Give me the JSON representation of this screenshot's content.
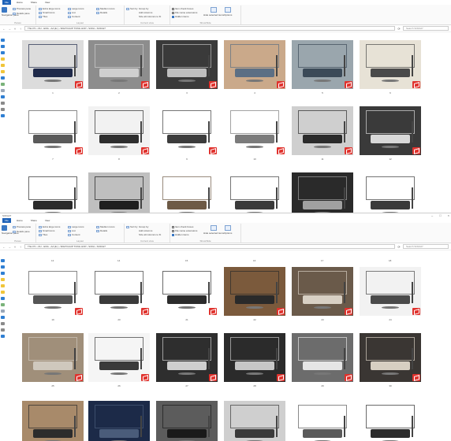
{
  "windows": [
    {
      "tabs": [
        "File",
        "Home",
        "Share",
        "View"
      ],
      "ribbon": {
        "pane_group": {
          "label": "Panes",
          "items": [
            "Navigation pane",
            "Preview pane",
            "Details pane"
          ]
        },
        "layout_group": {
          "label": "Layout",
          "items": [
            "Extra large icons",
            "Large icons",
            "Medium icons",
            "Small icons",
            "List",
            "Details",
            "Tiles",
            "Content"
          ]
        },
        "view_group": {
          "label": "Current view",
          "items": [
            "Sort by",
            "Group by",
            "Add columns",
            "Size all columns to fit"
          ]
        },
        "show_group": {
          "label": "Show/hide",
          "items": [
            "Item check boxes",
            "File name extensions",
            "Hidden items"
          ],
          "checked": [
            false,
            false,
            true
          ],
          "hide_label": "Hide selected items",
          "options_label": "Options"
        }
      },
      "address": {
        "path": "This PC  ›  DU - ENG - AA (E:)  ›  SKETCHUP TONG HOP  ›  SOFA  ›  SOFA27",
        "search_placeholder": "Search SOFA27"
      },
      "thumbs": [
        {
          "label": "1"
        },
        {
          "label": "2"
        },
        {
          "label": "3"
        },
        {
          "label": "4"
        },
        {
          "label": "5"
        },
        {
          "label": "6"
        },
        {
          "label": "7"
        },
        {
          "label": "8"
        },
        {
          "label": "9"
        },
        {
          "label": "10"
        },
        {
          "label": "11"
        },
        {
          "label": "12"
        },
        {
          "label": ""
        },
        {
          "label": ""
        },
        {
          "label": ""
        },
        {
          "label": ""
        },
        {
          "label": ""
        },
        {
          "label": ""
        }
      ]
    },
    {
      "title": "SOFA27",
      "tabs": [
        "File",
        "Home",
        "Share",
        "View"
      ],
      "ribbon": {
        "pane_group": {
          "label": "Panes",
          "items": [
            "Navigation pane",
            "Preview pane",
            "Details pane"
          ]
        },
        "layout_group": {
          "label": "Layout",
          "items": [
            "Extra large icons",
            "Large icons",
            "Medium icons",
            "Small icons",
            "List",
            "Details",
            "Tiles",
            "Content"
          ]
        },
        "view_group": {
          "label": "Current view",
          "items": [
            "Sort by",
            "Group by",
            "Add columns",
            "Size all columns to fit"
          ]
        },
        "show_group": {
          "label": "Show/hide",
          "items": [
            "Item check boxes",
            "File name extensions",
            "Hidden items"
          ],
          "checked": [
            false,
            false,
            true
          ],
          "hide_label": "Hide selected items",
          "options_label": "Options"
        }
      },
      "address": {
        "path": "This PC  ›  DU - ENG - AA (E:)  ›  SKETCHUP TONG HOP  ›  SOFA  ›  SOFA27",
        "search_placeholder": "Search SOFA27"
      },
      "top_labels": [
        "13",
        "14",
        "15",
        "16",
        "17",
        "18"
      ],
      "thumbs": [
        {
          "label": "19"
        },
        {
          "label": "20"
        },
        {
          "label": "21"
        },
        {
          "label": "22"
        },
        {
          "label": "23"
        },
        {
          "label": "24"
        },
        {
          "label": "25"
        },
        {
          "label": "26"
        },
        {
          "label": "27"
        },
        {
          "label": "28"
        },
        {
          "label": "29"
        },
        {
          "label": "30"
        },
        {
          "label": ""
        },
        {
          "label": ""
        },
        {
          "label": ""
        },
        {
          "label": ""
        },
        {
          "label": ""
        },
        {
          "label": ""
        }
      ]
    }
  ],
  "colors": {
    "accent": "#1e62b8",
    "badge": "#e0322d"
  }
}
